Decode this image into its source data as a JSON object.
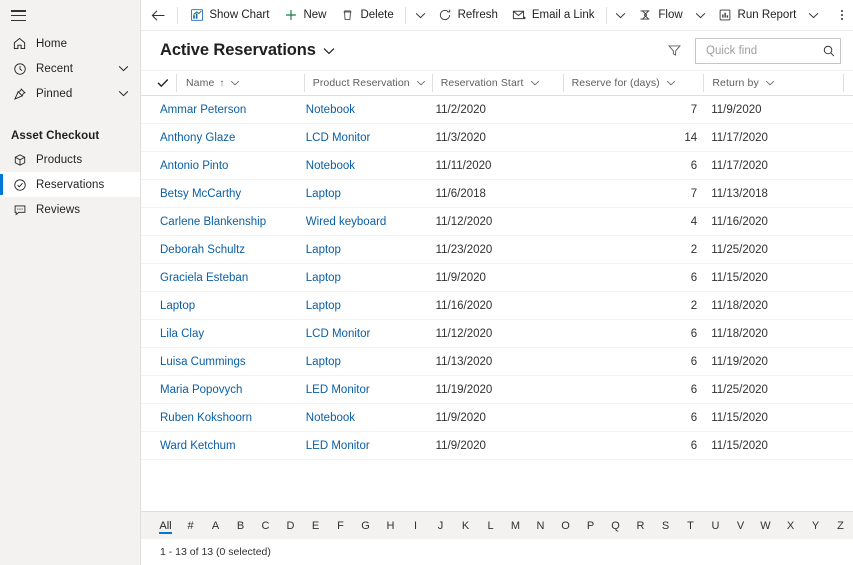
{
  "sidebar": {
    "hamburger": "site-map-toggle",
    "nav": [
      {
        "label": "Home",
        "icon": "home-icon",
        "chevron": false
      },
      {
        "label": "Recent",
        "icon": "clock-icon",
        "chevron": true
      },
      {
        "label": "Pinned",
        "icon": "pin-icon",
        "chevron": true
      }
    ],
    "group_title": "Asset Checkout",
    "area_items": [
      {
        "label": "Products",
        "icon": "box-icon",
        "selected": false
      },
      {
        "label": "Reservations",
        "icon": "check-circle-icon",
        "selected": true
      },
      {
        "label": "Reviews",
        "icon": "comment-icon",
        "selected": false
      }
    ]
  },
  "commandbar": {
    "back": "back-arrow",
    "buttons": [
      {
        "label": "Show Chart",
        "icon": "chart-icon",
        "caret": false
      },
      {
        "label": "New",
        "icon": "plus-icon",
        "caret": false
      },
      {
        "label": "Delete",
        "icon": "trash-icon",
        "caret": true
      },
      {
        "label": "Refresh",
        "icon": "refresh-icon",
        "caret": false
      },
      {
        "label": "Email a Link",
        "icon": "email-icon",
        "caret": true
      },
      {
        "label": "Flow",
        "icon": "flow-icon",
        "caret": true
      },
      {
        "label": "Run Report",
        "icon": "report-icon",
        "caret": true
      }
    ],
    "more": "overflow-menu"
  },
  "viewheader": {
    "title": "Active Reservations",
    "title_caret": "chevron-down-icon",
    "filter_icon": "filter-icon",
    "search": {
      "placeholder": "Quick find",
      "value": "",
      "icon": "search-icon"
    }
  },
  "grid": {
    "columns": [
      {
        "label": "Name",
        "sorted": "asc",
        "class": "col-name",
        "divider": false
      },
      {
        "label": "Product Reservation",
        "sorted": "",
        "class": "col-prod",
        "divider": true
      },
      {
        "label": "Reservation Start",
        "sorted": "",
        "class": "col-start",
        "divider": true
      },
      {
        "label": "Reserve for (days)",
        "sorted": "",
        "class": "col-days",
        "divider": true
      },
      {
        "label": "Return by",
        "sorted": "",
        "class": "col-return",
        "divider": true
      }
    ],
    "rows": [
      {
        "name": "Ammar Peterson",
        "product": "Notebook",
        "start": "11/2/2020",
        "days": "7",
        "return": "11/9/2020"
      },
      {
        "name": "Anthony Glaze",
        "product": "LCD Monitor",
        "start": "11/3/2020",
        "days": "14",
        "return": "11/17/2020"
      },
      {
        "name": "Antonio Pinto",
        "product": "Notebook",
        "start": "11/11/2020",
        "days": "6",
        "return": "11/17/2020"
      },
      {
        "name": "Betsy McCarthy",
        "product": "Laptop",
        "start": "11/6/2018",
        "days": "7",
        "return": "11/13/2018"
      },
      {
        "name": "Carlene Blankenship",
        "product": "Wired keyboard",
        "start": "11/12/2020",
        "days": "4",
        "return": "11/16/2020"
      },
      {
        "name": "Deborah Schultz",
        "product": "Laptop",
        "start": "11/23/2020",
        "days": "2",
        "return": "11/25/2020"
      },
      {
        "name": "Graciela Esteban",
        "product": "Laptop",
        "start": "11/9/2020",
        "days": "6",
        "return": "11/15/2020"
      },
      {
        "name": "Laptop",
        "product": "Laptop",
        "start": "11/16/2020",
        "days": "2",
        "return": "11/18/2020"
      },
      {
        "name": "Lila Clay",
        "product": "LCD Monitor",
        "start": "11/12/2020",
        "days": "6",
        "return": "11/18/2020"
      },
      {
        "name": "Luisa Cummings",
        "product": "Laptop",
        "start": "11/13/2020",
        "days": "6",
        "return": "11/19/2020"
      },
      {
        "name": "Maria Popovych",
        "product": "LED Monitor",
        "start": "11/19/2020",
        "days": "6",
        "return": "11/25/2020"
      },
      {
        "name": "Ruben Kokshoorn",
        "product": "Notebook",
        "start": "11/9/2020",
        "days": "6",
        "return": "11/15/2020"
      },
      {
        "name": "Ward Ketchum",
        "product": "LED Monitor",
        "start": "11/9/2020",
        "days": "6",
        "return": "11/15/2020"
      }
    ]
  },
  "alphabet": {
    "active": "All",
    "items": [
      "All",
      "#",
      "A",
      "B",
      "C",
      "D",
      "E",
      "F",
      "G",
      "H",
      "I",
      "J",
      "K",
      "L",
      "M",
      "N",
      "O",
      "P",
      "Q",
      "R",
      "S",
      "T",
      "U",
      "V",
      "W",
      "X",
      "Y",
      "Z"
    ]
  },
  "statusbar": {
    "text": "1 - 13 of 13 (0 selected)"
  },
  "colors": {
    "accent": "#0078d4",
    "link": "#0b5fa5",
    "sidebar_bg": "#f3f2f1",
    "text": "#201f1e",
    "muted": "#605e5c",
    "new_green": "#107c41"
  }
}
